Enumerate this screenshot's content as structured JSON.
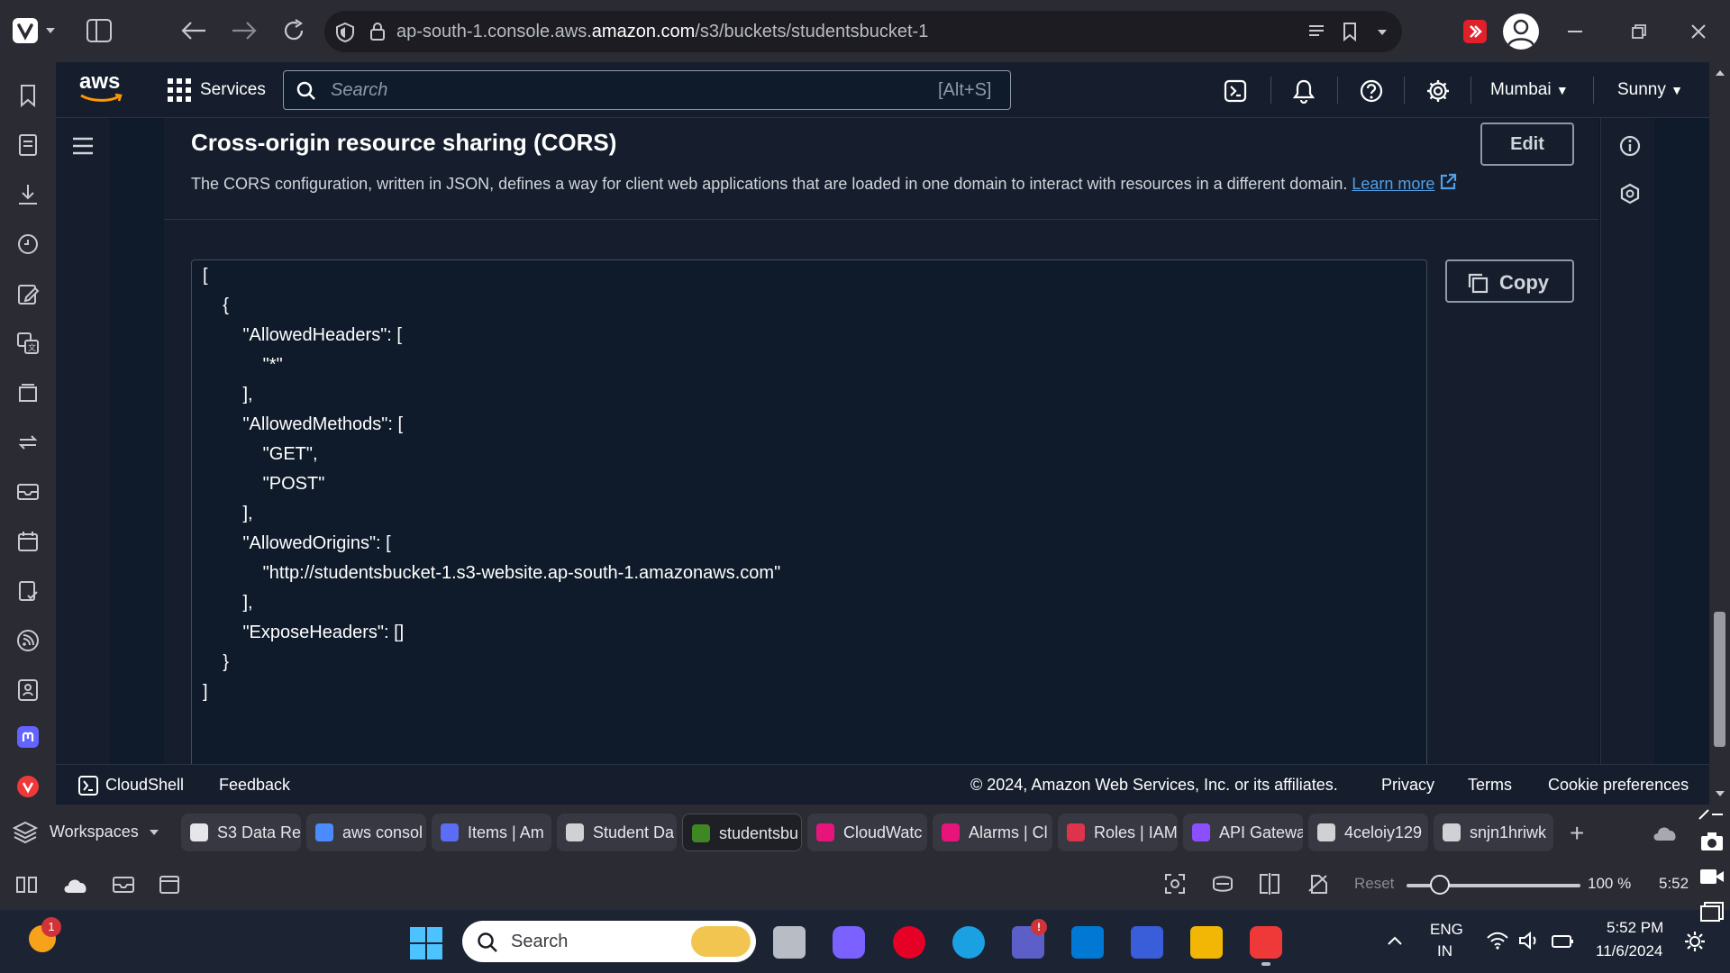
{
  "browser": {
    "url_prefix": "ap-south-1.console.aws.",
    "url_domain": "amazon.com",
    "url_path": "/s3/buckets/studentsbucket-1"
  },
  "aws_header": {
    "logo": "aws",
    "services_label": "Services",
    "search_placeholder": "Search",
    "search_shortcut": "[Alt+S]",
    "region": "Mumbai",
    "user": "Sunny"
  },
  "cors": {
    "title": "Cross-origin resource sharing (CORS)",
    "description": "The CORS configuration, written in JSON, defines a way for client web applications that are loaded in one domain to interact with resources in a different domain.",
    "learn_more": "Learn more",
    "edit_label": "Edit",
    "copy_label": "Copy",
    "code_lines": [
      "[",
      "    {",
      "        \"AllowedHeaders\": [",
      "            \"*\"",
      "        ],",
      "        \"AllowedMethods\": [",
      "            \"GET\",",
      "            \"POST\"",
      "        ],",
      "        \"AllowedOrigins\": [",
      "            \"http://studentsbucket-1.s3-website.ap-south-1.amazonaws.com\"",
      "        ],",
      "        \"ExposeHeaders\": []",
      "    }",
      "]"
    ]
  },
  "footer": {
    "cloudshell": "CloudShell",
    "feedback": "Feedback",
    "copyright": "© 2024, Amazon Web Services, Inc. or its affiliates.",
    "privacy": "Privacy",
    "terms": "Terms",
    "cookie": "Cookie preferences"
  },
  "tabs": {
    "workspaces": "Workspaces",
    "items": [
      {
        "label": "S3 Data Re",
        "color": "#e5e5ea"
      },
      {
        "label": "aws consol",
        "color": "#4a8cff"
      },
      {
        "label": "Items | Am",
        "color": "#5b6cf5"
      },
      {
        "label": "Student Da",
        "color": "#d0d0d5"
      },
      {
        "label": "studentsbu",
        "color": "#3f8624"
      },
      {
        "label": "CloudWatc",
        "color": "#e7157b"
      },
      {
        "label": "Alarms | Cl",
        "color": "#e7157b"
      },
      {
        "label": "Roles | IAM",
        "color": "#dd344c"
      },
      {
        "label": "API Gatewa",
        "color": "#8c4fff"
      },
      {
        "label": "4celoiy129",
        "color": "#d0d0d5"
      },
      {
        "label": "snjn1hriwk",
        "color": "#d0d0d5"
      }
    ]
  },
  "status_bar": {
    "reset": "Reset",
    "zoom": "100 %",
    "zoom_level": 0.19,
    "time": "5:52 PM"
  },
  "taskbar": {
    "search": "Search",
    "lang_top": "ENG",
    "lang_bottom": "IN",
    "time": "5:52 PM",
    "date": "11/6/2024",
    "notif_count": "1"
  }
}
